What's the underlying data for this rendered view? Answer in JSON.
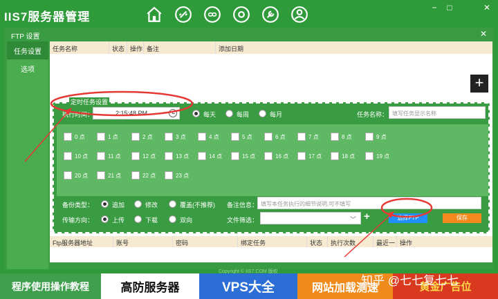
{
  "app": {
    "title": "IIS7服务器管理"
  },
  "dialog": {
    "title": "FTP 设置"
  },
  "sidebar": {
    "items": [
      {
        "label": "任务设置"
      },
      {
        "label": "选项"
      }
    ]
  },
  "tasks": {
    "columns": [
      "任务名称",
      "状态",
      "操作",
      "备注",
      "添加日期"
    ]
  },
  "schedule": {
    "section_label": "定时任务设置",
    "exec_time_label": "执行时间：",
    "exec_time_value": "2:15:48 PM",
    "frequency": [
      {
        "label": "每天",
        "checked": true
      },
      {
        "label": "每周",
        "checked": false
      },
      {
        "label": "每月",
        "checked": false
      }
    ],
    "task_name_label": "任务名称：",
    "task_name_placeholder": "填写任务显示名称",
    "hours": [
      "0 点",
      "1 点",
      "2 点",
      "3 点",
      "4 点",
      "5 点",
      "6 点",
      "7 点",
      "8 点",
      "9 点",
      "10 点",
      "11 点",
      "12 点",
      "13 点",
      "14 点",
      "15 点",
      "16 点",
      "17 点",
      "18 点",
      "19 点",
      "20 点",
      "21 点",
      "22 点",
      "23 点"
    ],
    "backup_type_label": "备份类型：",
    "backup_types": [
      {
        "label": "追加",
        "checked": true
      },
      {
        "label": "修改",
        "checked": false
      },
      {
        "label": "覆盖(不推荐)",
        "checked": false
      }
    ],
    "remark_label": "备注信息：",
    "remark_placeholder": "填写本任务执行的细节说明,可不填写",
    "direction_label": "传输方向：",
    "directions": [
      {
        "label": "上传",
        "checked": true
      },
      {
        "label": "下载",
        "checked": false
      },
      {
        "label": "双向",
        "checked": false
      }
    ],
    "file_filter_label": "文件筛选：",
    "select_ftp_label": "选择FTP",
    "save_label": "保存"
  },
  "ftp_grid": {
    "columns": [
      "Ftp服务器地址",
      "账号",
      "密码",
      "绑定任务",
      "状态",
      "执行次数",
      "最近一",
      "操作"
    ]
  },
  "footer": "Copyright © IIS7.COM 版权",
  "banner": {
    "items": [
      {
        "label": "程序使用操作教程",
        "bg": "#3f9f4d",
        "fg": "#ffffff"
      },
      {
        "label": "高防服务器",
        "bg": "#ffffff",
        "fg": "#111111"
      },
      {
        "label": "VPS大全",
        "bg": "#2b6fd6",
        "fg": "#ffffff"
      },
      {
        "label": "网站加载测速",
        "bg": "#f08a1a",
        "fg": "#ffffff"
      },
      {
        "label": "黄金广告位",
        "bg": "#d93a1f",
        "fg": "#ffd84a"
      }
    ],
    "watermark": "知乎 @七七复七七"
  },
  "colors": {
    "app_green": "#2f9a3a",
    "panel_green": "#3a9c42",
    "accent_blue": "#1e90ff",
    "accent_orange": "#f28a1e",
    "annotation_red": "#e53935"
  }
}
